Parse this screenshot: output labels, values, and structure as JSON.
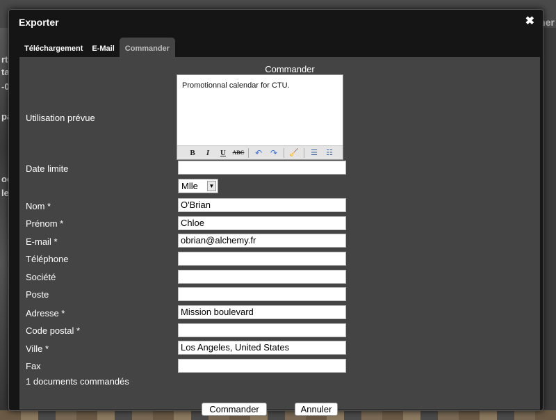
{
  "background": {
    "fragments": [
      "rt",
      "ta",
      "-0",
      "pa",
      "oc",
      "le"
    ],
    "right_fragment": "ner"
  },
  "modal": {
    "title": "Exporter",
    "close_glyph": "✖",
    "tabs": [
      {
        "label": "Téléchargement"
      },
      {
        "label": "E-Mail"
      },
      {
        "label": "Commander"
      }
    ],
    "active_tab": "Commander"
  },
  "form": {
    "heading": "Commander",
    "usage_label": "Utilisation prévue",
    "usage_text": "Promotionnal calendar for CTU.",
    "toolbar": {
      "bold": "B",
      "italic": "I",
      "underline": "U",
      "strike": "ABC",
      "undo": "↶",
      "redo": "↷",
      "clean": "🧹",
      "bullet_list": "☰",
      "numbered_list": "☷"
    },
    "deadline_label": "Date limite",
    "deadline_value": "",
    "title_select": "Mlle",
    "fields": {
      "nom": {
        "label": "Nom *",
        "value": "O'Brian"
      },
      "prenom": {
        "label": "Prénom *",
        "value": "Chloe"
      },
      "email": {
        "label": "E-mail *",
        "value": "obrian@alchemy.fr"
      },
      "telephone": {
        "label": "Téléphone",
        "value": ""
      },
      "societe": {
        "label": "Société",
        "value": ""
      },
      "poste": {
        "label": "Poste",
        "value": ""
      },
      "adresse": {
        "label": "Adresse *",
        "value": "Mission boulevard"
      },
      "code_postal": {
        "label": "Code postal *",
        "value": ""
      },
      "ville": {
        "label": "Ville *",
        "value": "Los Angeles, United States"
      },
      "fax": {
        "label": "Fax",
        "value": ""
      }
    },
    "documents_count": "1 documents commandés",
    "submit_label": "Commander",
    "cancel_label": "Annuler"
  }
}
